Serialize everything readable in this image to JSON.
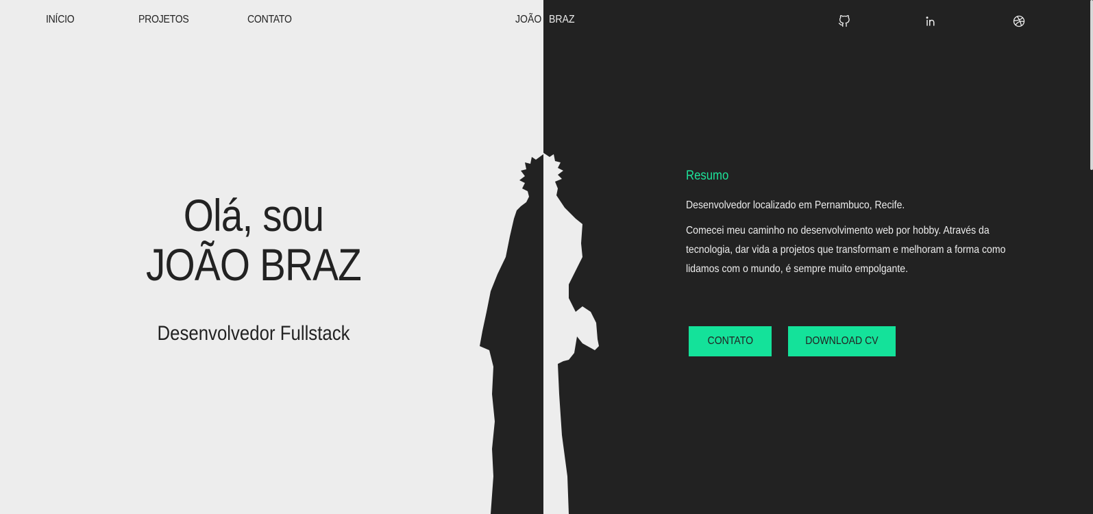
{
  "nav": {
    "items": [
      {
        "label": "INÍCIO"
      },
      {
        "label": "PROJETOS"
      },
      {
        "label": "CONTATO"
      }
    ]
  },
  "brand": {
    "first": "JOÃO",
    "last": "BRAZ"
  },
  "social": {
    "icons": [
      "github-icon",
      "linkedin-icon",
      "dribbble-icon"
    ]
  },
  "hero": {
    "greeting": "Olá, sou",
    "name": "JOÃO BRAZ",
    "role": "Desenvolvedor Fullstack"
  },
  "summary": {
    "title": "Resumo",
    "location": "Desenvolvedor localizado em Pernambuco, Recife.",
    "paragraph": "Comecei meu caminho no desenvolvimento web por hobby. Através da tecnologia, dar vida a projetos que transformam e melhoram a forma como lidamos com o mundo, é sempre muito empolgante."
  },
  "buttons": {
    "contact": "CONTATO",
    "download": "DOWNLOAD CV"
  },
  "colors": {
    "accent": "#14e29a",
    "dark": "#222222",
    "light": "#ededed"
  }
}
